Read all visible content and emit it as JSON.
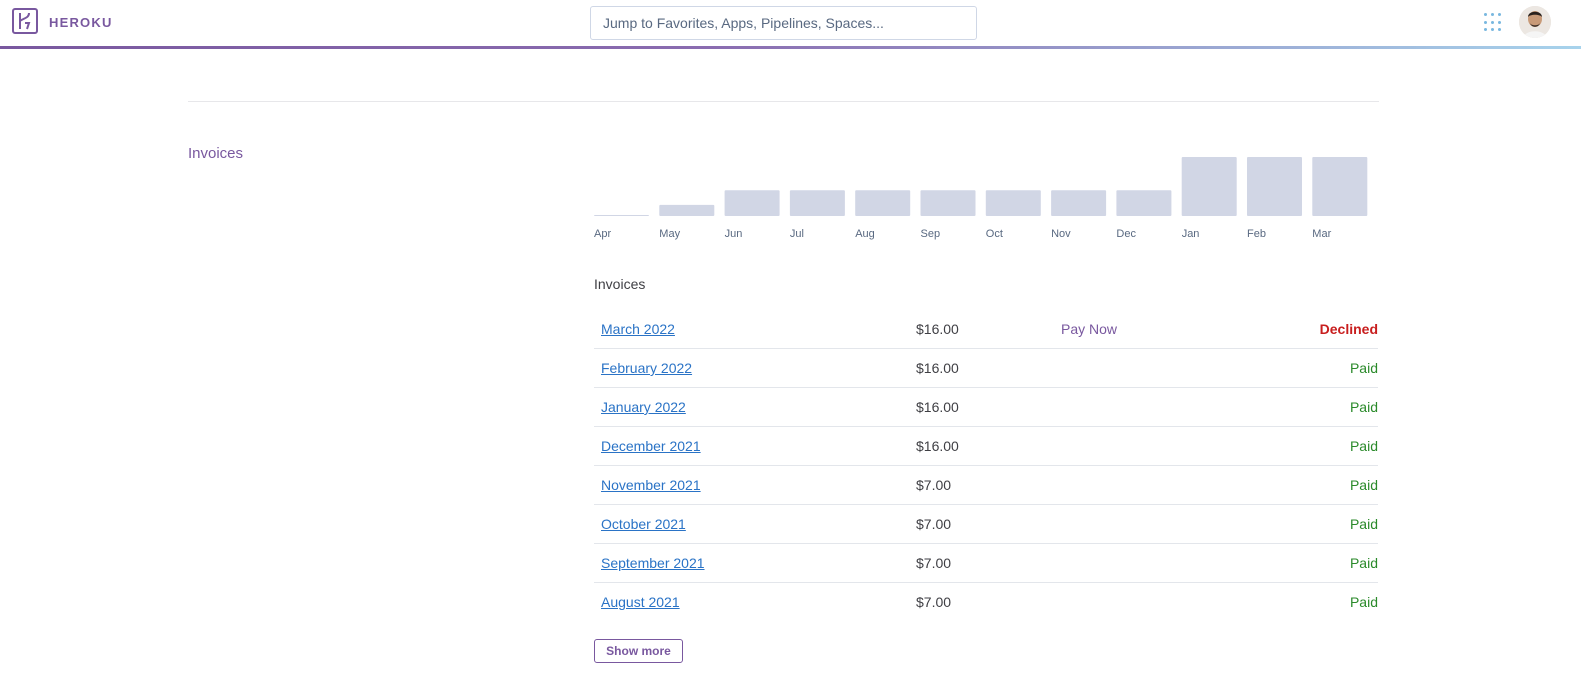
{
  "header": {
    "brand": "HEROKU",
    "search_placeholder": "Jump to Favorites, Apps, Pipelines, Spaces...",
    "apps_icon": "grid-dots-icon",
    "avatar": "user-avatar"
  },
  "section": {
    "title": "Invoices"
  },
  "chart_data": {
    "type": "bar",
    "categories": [
      "Apr",
      "May",
      "Jun",
      "Jul",
      "Aug",
      "Sep",
      "Oct",
      "Nov",
      "Dec",
      "Jan",
      "Feb",
      "Mar"
    ],
    "values": [
      0,
      3,
      7,
      7,
      7,
      7,
      7,
      7,
      7,
      16,
      16,
      16
    ],
    "ylim": [
      0,
      16
    ],
    "bar_color": "#d1d6e5",
    "grid": false
  },
  "invoices": {
    "label": "Invoices",
    "rows": [
      {
        "month": "March 2022",
        "amount": "$16.00",
        "action": "Pay Now",
        "status": "Declined"
      },
      {
        "month": "February 2022",
        "amount": "$16.00",
        "action": "",
        "status": "Paid"
      },
      {
        "month": "January 2022",
        "amount": "$16.00",
        "action": "",
        "status": "Paid"
      },
      {
        "month": "December 2021",
        "amount": "$16.00",
        "action": "",
        "status": "Paid"
      },
      {
        "month": "November 2021",
        "amount": "$7.00",
        "action": "",
        "status": "Paid"
      },
      {
        "month": "October 2021",
        "amount": "$7.00",
        "action": "",
        "status": "Paid"
      },
      {
        "month": "September 2021",
        "amount": "$7.00",
        "action": "",
        "status": "Paid"
      },
      {
        "month": "August 2021",
        "amount": "$7.00",
        "action": "",
        "status": "Paid"
      }
    ],
    "show_more": "Show more"
  },
  "colors": {
    "brand": "#79589f",
    "link": "#2a73c6",
    "paid": "#2a8a2a",
    "declined": "#c81e1e"
  }
}
